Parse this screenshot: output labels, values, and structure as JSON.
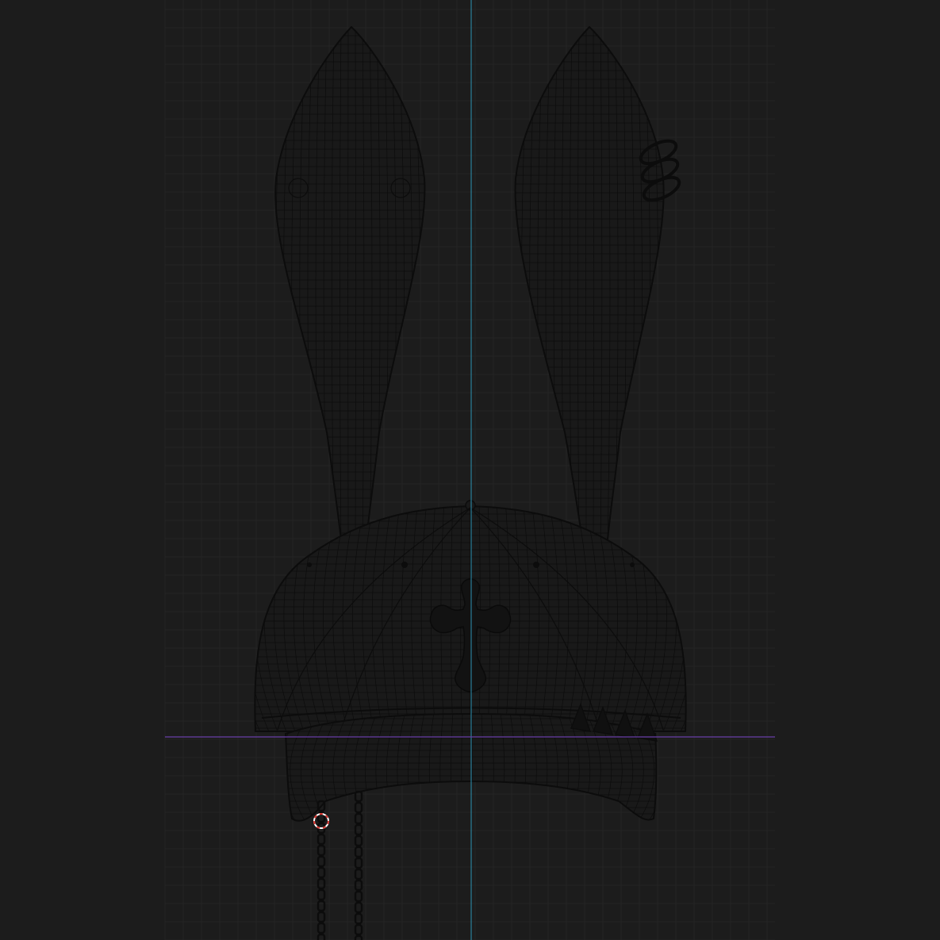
{
  "viewport": {
    "background": "#1c1c1c",
    "grid_color": "#242424",
    "wire_color": "#0c0c0c",
    "mesh_fill": "#191919",
    "axis_y_color": "#2d93b4",
    "axis_x_color": "#6a3fa8",
    "cursor_color_a": "#d9302a",
    "cursor_color_b": "#ffffff"
  },
  "icons": {
    "cursor": "3d-cursor-icon",
    "cross": "gothic-cross-emblem-icon"
  },
  "mesh": {
    "object": "bunny-ear-cap",
    "ear_count": 2,
    "spike_count": 4,
    "ring_count": 3,
    "chain_count": 2
  }
}
